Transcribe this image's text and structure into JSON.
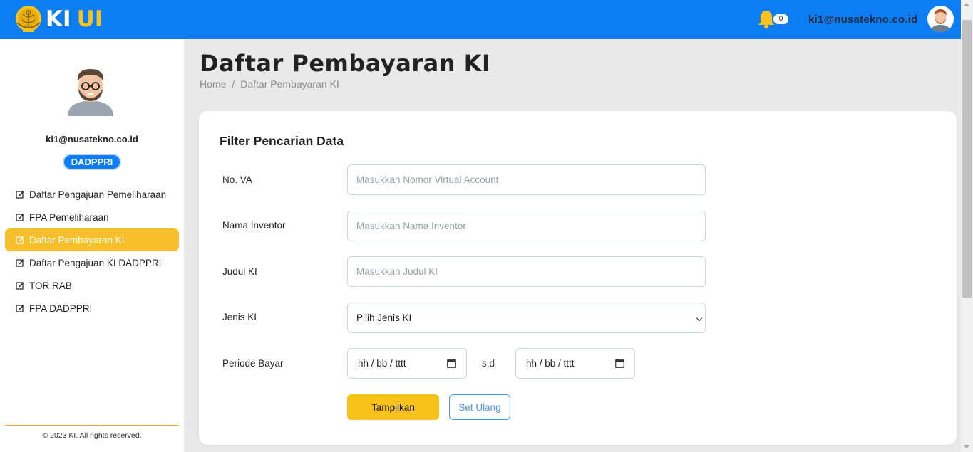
{
  "header": {
    "brand_k": "KI",
    "brand_u": "UI",
    "notification_count": "0",
    "user_email": "ki1@nusatekno.co.id",
    "icons": [
      "university-emblem-icon",
      "bell-icon",
      "avatar"
    ]
  },
  "sidebar": {
    "user_email": "ki1@nusatekno.co.id",
    "role": "DADPPRI",
    "items": [
      {
        "label": "Daftar Pengajuan Pemeliharaan",
        "active": false
      },
      {
        "label": "FPA Pemeliharaan",
        "active": false
      },
      {
        "label": "Daftar Pembayaran KI",
        "active": true
      },
      {
        "label": "Daftar Pengajuan KI DADPPRI",
        "active": false
      },
      {
        "label": "TOR RAB",
        "active": false
      },
      {
        "label": "FPA DADPPRI",
        "active": false
      }
    ],
    "footer": "© 2023 KI. All rights reserved."
  },
  "main": {
    "title": "Daftar Pembayaran KI",
    "breadcrumb": {
      "home": "Home",
      "separator": "/",
      "current": "Daftar Pembayaran KI"
    },
    "filter": {
      "title": "Filter Pencarian Data",
      "no_va_label": "No. VA",
      "no_va_placeholder": "Masukkan Nomor Virtual Account",
      "inventor_label": "Nama Inventor",
      "inventor_placeholder": "Masukkan Nama Inventor",
      "judul_label": "Judul KI",
      "judul_placeholder": "Masukkan Judul KI",
      "jenis_label": "Jenis KI",
      "jenis_selected": "Pilih Jenis KI",
      "periode_label": "Periode Bayar",
      "date_from": "hh / bb / tttt",
      "date_separator": "s.d",
      "date_to": "hh / bb / tttt",
      "submit_label": "Tampilkan",
      "reset_label": "Set Ulang"
    }
  },
  "colors": {
    "topbar": "#0d7df4",
    "accent_yellow": "#f7c21b",
    "active_menu": "#f7bf2a",
    "outline_blue": "#4d97e8"
  }
}
